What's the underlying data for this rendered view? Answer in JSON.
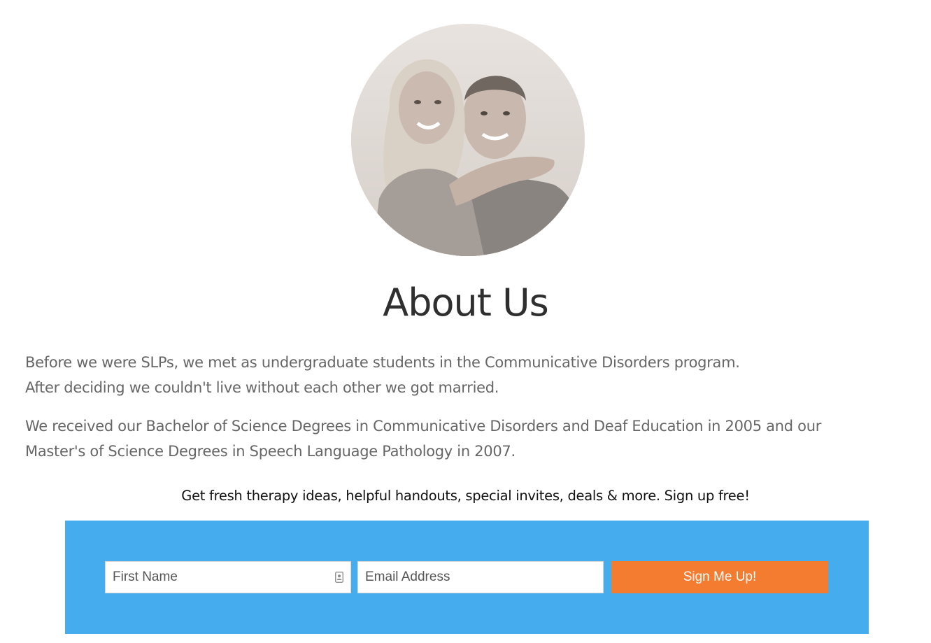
{
  "about": {
    "title": "About Us",
    "paragraph1": [
      "Before we were SLPs, we met as undergraduate students in the Communicative Disorders program.",
      "After deciding we couldn't live without each other we got married."
    ],
    "paragraph2": [
      "We received our Bachelor of Science Degrees in Communicative Disorders and Deaf Education in 2005 and our",
      "Master's of Science Degrees in Speech Language Pathology in 2007."
    ]
  },
  "signup": {
    "promo_text": "Get fresh therapy ideas, helpful handouts, special invites, deals & more. Sign up free!",
    "first_name_placeholder": "First Name",
    "email_placeholder": "Email Address",
    "button_label": "Sign Me Up!",
    "panel_color": "#45aded",
    "button_color": "#f47c30"
  },
  "icons": {
    "first_name_field": "contact-card-icon"
  }
}
